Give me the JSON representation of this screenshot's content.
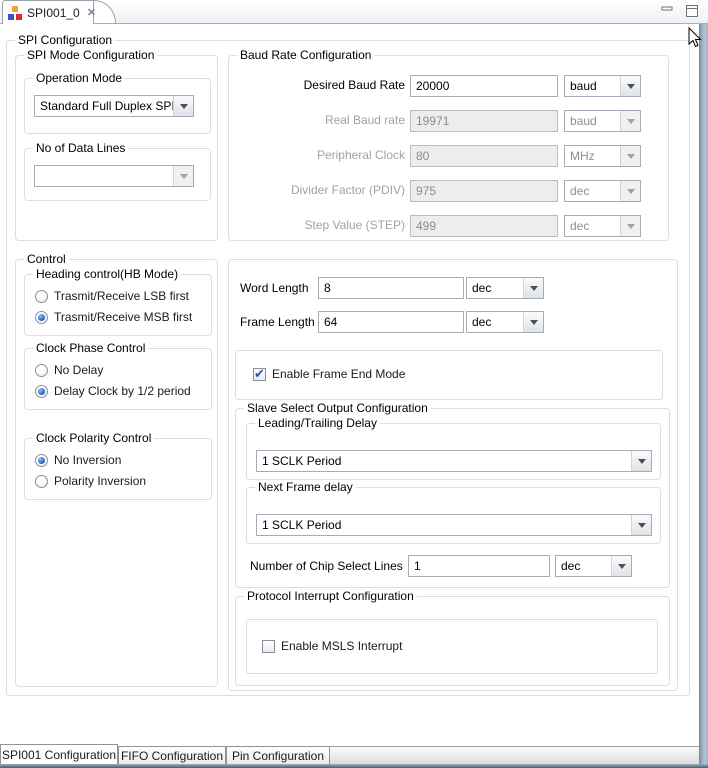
{
  "icons": {
    "close": "✕"
  },
  "colors": {
    "app_icon_orange": "#f0a232",
    "app_icon_blue": "#3a57c8",
    "app_icon_red": "#dc2a2a",
    "radio_selected": "#1d5abe",
    "checkbox_check": "#2a53b0",
    "group_border": "#d9dfe7",
    "window_edge": "#8499ad"
  },
  "editor_tab": {
    "title": "SPI001_0"
  },
  "main": {
    "title": "SPI Configuration",
    "spi_mode": {
      "title": "SPI Mode Configuration",
      "operation_mode": {
        "title": "Operation Mode",
        "value": "Standard Full Duplex SPI"
      },
      "data_lines": {
        "title": "No of Data Lines",
        "value": ""
      }
    },
    "baud": {
      "title": "Baud Rate Configuration",
      "rows": [
        {
          "label": "Desired Baud Rate",
          "value": "20000",
          "unit": "baud",
          "enabled": true
        },
        {
          "label": "Real Baud rate",
          "value": "19971",
          "unit": "baud",
          "enabled": false
        },
        {
          "label": "Peripheral Clock",
          "value": "80",
          "unit": "MHz",
          "enabled": false
        },
        {
          "label": "Divider Factor (PDIV)",
          "value": "975",
          "unit": "dec",
          "enabled": false
        },
        {
          "label": "Step Value (STEP)",
          "value": "499",
          "unit": "dec",
          "enabled": false
        }
      ]
    },
    "control": {
      "title": "Control",
      "heading": {
        "title": "Heading control(HB Mode)",
        "options": [
          "Trasmit/Receive LSB first",
          "Trasmit/Receive MSB first"
        ],
        "selected": 1
      },
      "phase": {
        "title": "Clock Phase Control",
        "options": [
          "No Delay",
          "Delay Clock by 1/2 period"
        ],
        "selected": 1
      },
      "polarity": {
        "title": "Clock Polarity Control",
        "options": [
          "No Inversion",
          "Polarity Inversion"
        ],
        "selected": 0
      }
    },
    "frame": {
      "word_length": {
        "label": "Word Length",
        "value": "8",
        "unit": "dec"
      },
      "frame_length": {
        "label": "Frame Length",
        "value": "64",
        "unit": "dec"
      },
      "frame_end": {
        "label": "Enable Frame End Mode",
        "checked": true
      },
      "slave_select": {
        "title": "Slave Select Output Configuration",
        "leading_delay": {
          "title": "Leading/Trailing Delay",
          "value": "1 SCLK Period"
        },
        "next_frame_delay": {
          "title": "Next Frame delay",
          "value": "1 SCLK Period"
        },
        "chip_select": {
          "label": "Number of Chip Select Lines",
          "value": "1",
          "unit": "dec"
        }
      },
      "interrupt": {
        "title": "Protocol Interrupt Configuration",
        "msls": {
          "label": "Enable MSLS Interrupt",
          "checked": false
        }
      }
    }
  },
  "bottom_tabs": [
    {
      "label": "SPI001 Configuration",
      "active": true
    },
    {
      "label": "FIFO Configuration",
      "active": false
    },
    {
      "label": "Pin Configuration",
      "active": false
    }
  ]
}
